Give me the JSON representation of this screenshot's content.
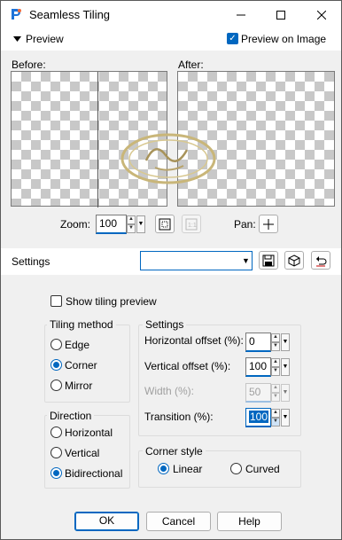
{
  "window": {
    "title": "Seamless Tiling"
  },
  "preview_bar": {
    "label": "Preview",
    "preview_on_image_label": "Preview on Image",
    "preview_on_image_checked": true
  },
  "before_label": "Before:",
  "after_label": "After:",
  "zoom": {
    "label": "Zoom:",
    "value": "100"
  },
  "pan_label": "Pan:",
  "settings_bar": {
    "label": "Settings",
    "preset_value": ""
  },
  "show_tiling_preview": {
    "label": "Show tiling preview",
    "checked": false
  },
  "tiling_method": {
    "title": "Tiling method",
    "options": [
      "Edge",
      "Corner",
      "Mirror"
    ],
    "selected": "Corner"
  },
  "settings_group": {
    "title": "Settings",
    "horizontal_offset": {
      "label": "Horizontal offset (%):",
      "value": "0"
    },
    "vertical_offset": {
      "label": "Vertical offset (%):",
      "value": "100"
    },
    "width": {
      "label": "Width (%):",
      "value": "50"
    },
    "transition": {
      "label": "Transition (%):",
      "value": "100"
    }
  },
  "direction": {
    "title": "Direction",
    "options": [
      "Horizontal",
      "Vertical",
      "Bidirectional"
    ],
    "selected": "Bidirectional"
  },
  "corner_style": {
    "title": "Corner style",
    "options": [
      "Linear",
      "Curved"
    ],
    "selected": "Linear"
  },
  "buttons": {
    "ok": "OK",
    "cancel": "Cancel",
    "help": "Help"
  },
  "colors": {
    "accent": "#0067c0",
    "window_bg": "#f0f0f0",
    "checker": "#c8c8c8"
  }
}
